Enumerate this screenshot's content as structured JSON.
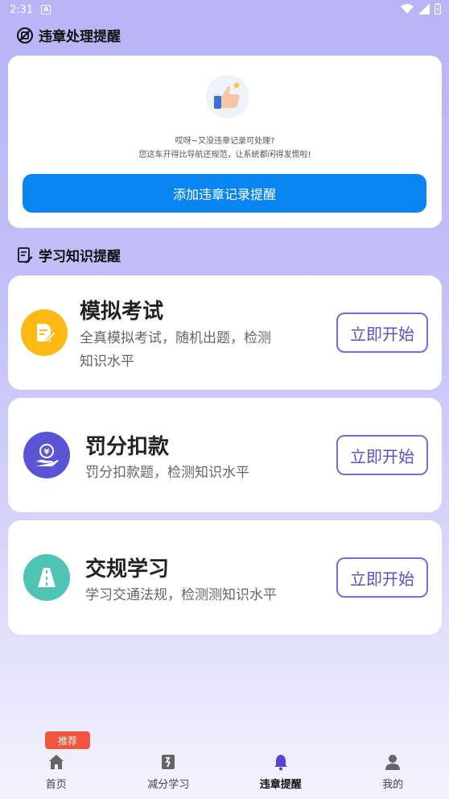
{
  "status_bar": {
    "time": "2:31",
    "notif_icon": "A"
  },
  "violation_section": {
    "title": "违章处理提醒",
    "empty_line1": "哎呀~又没违章记录可处理?",
    "empty_line2": "您这车开得比导航还规范，让系统都闲得发慌啦!",
    "add_button": "添加违章记录提醒"
  },
  "study_section": {
    "title": "学习知识提醒",
    "cards": [
      {
        "title": "模拟考试",
        "desc_line1": "全真模拟考试，随机出题，检测",
        "desc_line2": "知识水平",
        "button": "立即开始",
        "icon": "document-edit-icon",
        "color": "#fdb914"
      },
      {
        "title": "罚分扣款",
        "desc_line1": "罚分扣款题，检测知识水平",
        "desc_line2": "",
        "button": "立即开始",
        "icon": "yen-hand-icon",
        "color": "#5a55d6"
      },
      {
        "title": "交规学习",
        "desc_line1": "学习交通法规，检测测知识水平",
        "desc_line2": "",
        "button": "立即开始",
        "icon": "road-icon",
        "color": "#4fc3b4"
      }
    ]
  },
  "bottom_nav": {
    "badge": "推荐",
    "items": [
      {
        "label": "首页",
        "icon": "home-icon"
      },
      {
        "label": "减分学习",
        "icon": "book-icon"
      },
      {
        "label": "违章提醒",
        "icon": "bell-icon"
      },
      {
        "label": "我的",
        "icon": "user-icon"
      }
    ],
    "active_index": 2,
    "active_color": "#5b3fd6"
  }
}
